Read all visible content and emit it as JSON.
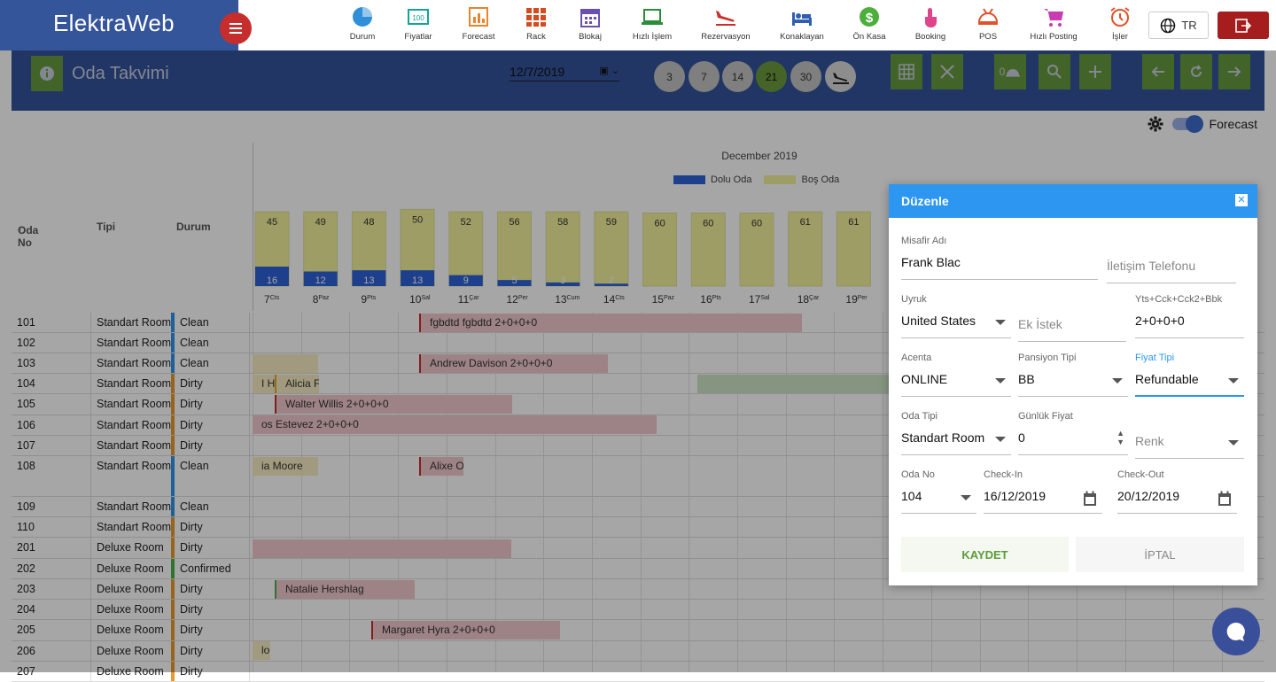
{
  "brand": {
    "name": "ElektraWeb"
  },
  "nav": [
    {
      "label": "Durum",
      "icon": "pie-chart-icon",
      "color": "#2f8fd8"
    },
    {
      "label": "Fiyatlar",
      "icon": "price-board-icon",
      "color": "#14a39a"
    },
    {
      "label": "Forecast",
      "icon": "bar-chart-icon",
      "color": "#e8842b"
    },
    {
      "label": "Rack",
      "icon": "grid-icon",
      "color": "#d44b1e"
    },
    {
      "label": "Blokaj",
      "icon": "calendar-icon",
      "color": "#6a4fb3"
    },
    {
      "label": "Hızlı İşlem",
      "icon": "laptop-icon",
      "color": "#2b8c3b"
    },
    {
      "label": "Rezervasyon",
      "icon": "plane-landing-icon",
      "color": "#c9302c"
    },
    {
      "label": "Konaklayan",
      "icon": "bed-icon",
      "color": "#2f5fb0"
    },
    {
      "label": "Ön Kasa",
      "icon": "dollar-icon",
      "color": "#4cae3b"
    },
    {
      "label": "Booking",
      "icon": "touch-icon",
      "color": "#e0448b"
    },
    {
      "label": "POS",
      "icon": "room-service-icon",
      "color": "#e0522b"
    },
    {
      "label": "Hızlı Posting",
      "icon": "cart-icon",
      "color": "#c83bb3"
    },
    {
      "label": "İşler",
      "icon": "alarm-clock-icon",
      "color": "#e0522b"
    }
  ],
  "lang": "TR",
  "page": {
    "title": "Oda Takvimi",
    "date": "12/7/2019",
    "day_buttons": [
      "3",
      "7",
      "14",
      "21",
      "30"
    ],
    "active_day": "21",
    "room_count_btn": "0"
  },
  "forecast_label": "Forecast",
  "chart_data": {
    "type": "bar",
    "title": "December 2019",
    "series": [
      {
        "name": "Dolu Oda",
        "color": "#2f63d8",
        "values": [
          16,
          12,
          13,
          13,
          9,
          5,
          3,
          2,
          0,
          0,
          0,
          0,
          0
        ]
      },
      {
        "name": "Boş Oda",
        "color": "#f2f29b",
        "values": [
          45,
          49,
          48,
          50,
          52,
          56,
          58,
          59,
          60,
          60,
          60,
          61,
          61
        ]
      }
    ],
    "categories": [
      "7",
      "8",
      "9",
      "10",
      "11",
      "12",
      "13",
      "14",
      "15",
      "16",
      "17",
      "18",
      "19"
    ],
    "day_names": [
      "Cts",
      "Paz",
      "Pts",
      "Sal",
      "Çar",
      "Per",
      "Cum",
      "Cts",
      "Paz",
      "Pts",
      "Sal",
      "Çar",
      "Per"
    ]
  },
  "columns": {
    "no": "Oda No",
    "type": "Tipi",
    "status": "Durum"
  },
  "rooms": [
    {
      "no": "101",
      "type": "Standart Room",
      "status": "Clean",
      "flag": "#2c96f0"
    },
    {
      "no": "102",
      "type": "Standart Room",
      "status": "Clean",
      "flag": "#2c96f0"
    },
    {
      "no": "103",
      "type": "Standart Room",
      "status": "Clean",
      "flag": "#2c96f0"
    },
    {
      "no": "104",
      "type": "Standart Room",
      "status": "Dirty",
      "flag": "#e89a2c"
    },
    {
      "no": "105",
      "type": "Standart Room",
      "status": "Dirty",
      "flag": "#e89a2c"
    },
    {
      "no": "106",
      "type": "Standart Room",
      "status": "Dirty",
      "flag": "#e89a2c"
    },
    {
      "no": "107",
      "type": "Standart Room",
      "status": "Dirty",
      "flag": "#e89a2c"
    },
    {
      "no": "108",
      "type": "Standart Room",
      "status": "Clean",
      "flag": "#2c96f0"
    },
    {
      "no": "109",
      "type": "Standart Room",
      "status": "Clean",
      "flag": "#2c96f0"
    },
    {
      "no": "110",
      "type": "Standart Room",
      "status": "Dirty",
      "flag": "#e89a2c"
    },
    {
      "no": "201",
      "type": "Deluxe Room",
      "status": "Dirty",
      "flag": "#e89a2c"
    },
    {
      "no": "202",
      "type": "Deluxe Room",
      "status": "Confirmed",
      "flag": "#4caf50"
    },
    {
      "no": "203",
      "type": "Deluxe Room",
      "status": "Dirty",
      "flag": "#e89a2c"
    },
    {
      "no": "204",
      "type": "Deluxe Room",
      "status": "Dirty",
      "flag": "#e89a2c"
    },
    {
      "no": "205",
      "type": "Deluxe Room",
      "status": "Dirty",
      "flag": "#e89a2c"
    },
    {
      "no": "206",
      "type": "Deluxe Room",
      "status": "Dirty",
      "flag": "#e89a2c"
    },
    {
      "no": "207",
      "type": "Deluxe Room",
      "status": "Dirty",
      "flag": "#e89a2c"
    }
  ],
  "reservations": [
    {
      "label": "fgbdtd fgbdtd 2+0+0+0"
    },
    {
      "label": "Andrew Davison 2+0+0+0"
    },
    {
      "label": "Alicia F"
    },
    {
      "label": "I He"
    },
    {
      "label": "Walter Willis 2+0+0+0"
    },
    {
      "label": "os Estevez 2+0+0+0"
    },
    {
      "label": "ia Moore"
    },
    {
      "label": "Alixe Ol"
    },
    {
      "label": "Natalie Hershlag"
    },
    {
      "label": "Margaret Hyra 2+0+0+0"
    },
    {
      "label": "lon"
    }
  ],
  "dialog": {
    "title": "Düzenle",
    "fields": {
      "guest_name": {
        "label": "Misafir Adı",
        "value": "Frank Blac"
      },
      "phone": {
        "placeholder": "İletişim Telefonu"
      },
      "nationality": {
        "label": "Uyruk",
        "value": "United States"
      },
      "extra_request": {
        "placeholder": "Ek İstek"
      },
      "pax": {
        "label": "Yts+Cck+Cck2+Bbk",
        "value": "2+0+0+0"
      },
      "agency": {
        "label": "Acenta",
        "value": "ONLINE"
      },
      "board": {
        "label": "Pansiyon Tipi",
        "value": "BB"
      },
      "rate_type": {
        "label": "Fiyat Tipi",
        "value": "Refundable"
      },
      "room_type": {
        "label": "Oda Tipi",
        "value": "Standart Room"
      },
      "daily_price": {
        "label": "Günlük Fiyat",
        "value": "0"
      },
      "color": {
        "placeholder": "Renk"
      },
      "room_no": {
        "label": "Oda No",
        "value": "104"
      },
      "checkin": {
        "label": "Check-In",
        "value": "16/12/2019"
      },
      "checkout": {
        "label": "Check-Out",
        "value": "20/12/2019"
      }
    },
    "save": "KAYDET",
    "cancel": "İPTAL"
  }
}
